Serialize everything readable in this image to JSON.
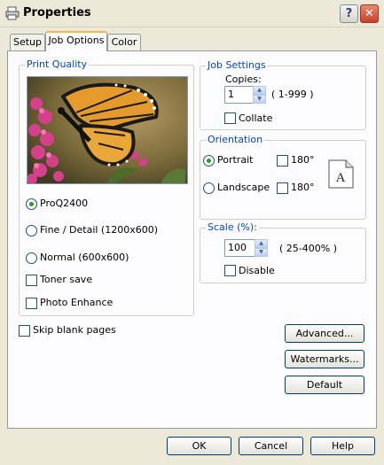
{
  "window": {
    "title": "Properties",
    "help_label": "?",
    "close_label": "✕"
  },
  "tabs": [
    {
      "label": "Setup"
    },
    {
      "label": "Job Options"
    },
    {
      "label": "Color"
    }
  ],
  "print_quality": {
    "group_label": "Print Quality",
    "options": [
      {
        "label": "ProQ2400",
        "selected": true
      },
      {
        "label": "Fine / Detail (1200x600)",
        "selected": false
      },
      {
        "label": "Normal (600x600)",
        "selected": false
      }
    ],
    "toner_save_label": "Toner save",
    "photo_enhance_label": "Photo Enhance"
  },
  "skip_blank_label": "Skip blank pages",
  "job_settings": {
    "group_label": "Job Settings",
    "copies_label": "Copies:",
    "copies_value": "1",
    "copies_range": "( 1-999 )",
    "collate_label": "Collate"
  },
  "orientation": {
    "group_label": "Orientation",
    "portrait_label": "Portrait",
    "landscape_label": "Landscape",
    "portrait_180_label": "180°",
    "landscape_180_label": "180°",
    "portrait_selected": true,
    "doc_icon_letter": "A"
  },
  "scale": {
    "group_label": "Scale (%):",
    "value": "100",
    "range": "( 25-400% )",
    "disable_label": "Disable"
  },
  "buttons": {
    "advanced": "Advanced...",
    "watermarks": "Watermarks...",
    "default": "Default",
    "ok": "OK",
    "cancel": "Cancel",
    "help": "Help"
  },
  "colors": {
    "group_label": "#0046d5",
    "radio_dot": "#21a121",
    "tab_highlight": "#f7b64a"
  }
}
